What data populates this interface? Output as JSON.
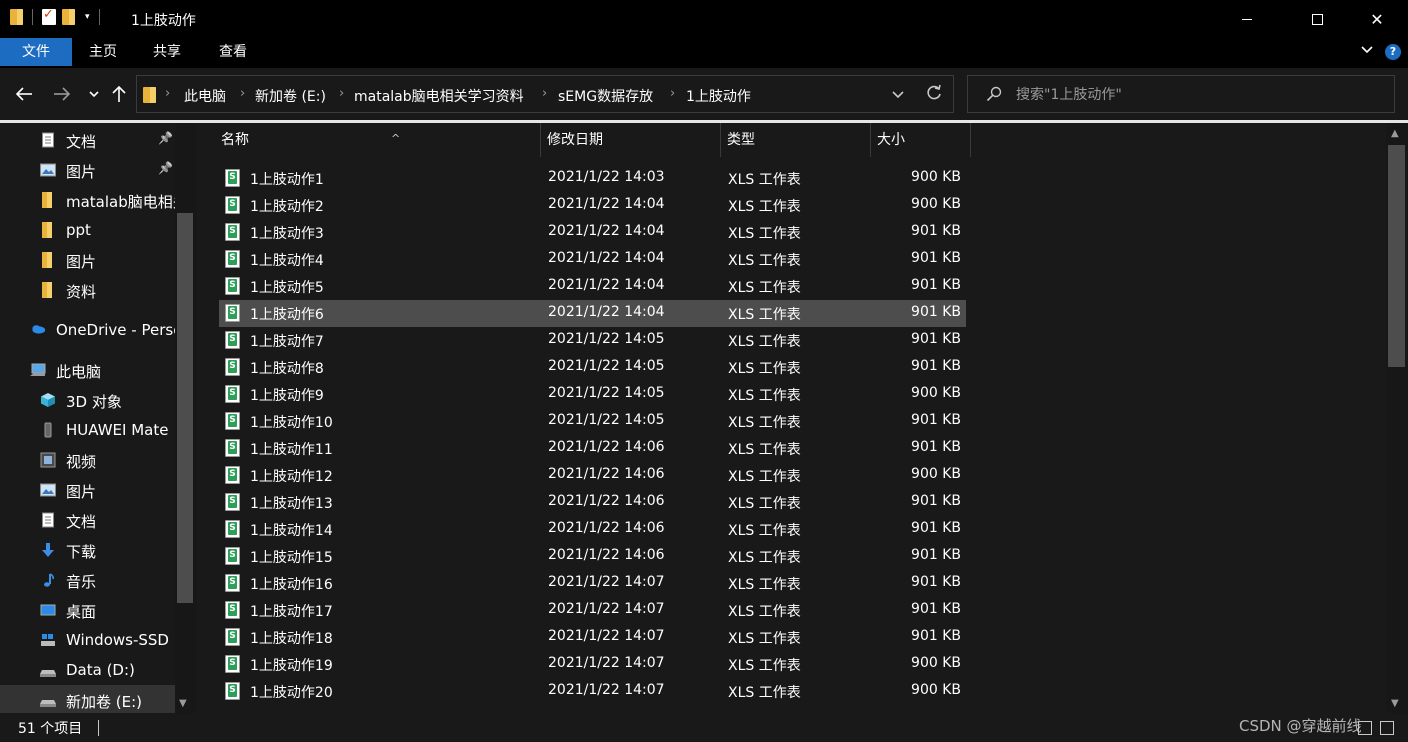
{
  "window": {
    "title": "1上肢动作"
  },
  "ribbon": {
    "tabs": [
      "文件",
      "主页",
      "共享",
      "查看"
    ]
  },
  "address": {
    "crumbs": [
      "此电脑",
      "新加卷 (E:)",
      "matalab脑电相关学习资料",
      "sEMG数据存放",
      "1上肢动作"
    ]
  },
  "search": {
    "placeholder": "搜索\"1上肢动作\""
  },
  "nav": {
    "items": [
      {
        "label": "文档",
        "icon": "document-icon",
        "pinned": true
      },
      {
        "label": "图片",
        "icon": "picture-icon",
        "pinned": true
      },
      {
        "label": "matalab脑电相关",
        "icon": "folder-icon",
        "pinned": false
      },
      {
        "label": "ppt",
        "icon": "folder-icon",
        "pinned": false
      },
      {
        "label": "图片",
        "icon": "folder-icon",
        "pinned": false
      },
      {
        "label": "资料",
        "icon": "folder-icon",
        "pinned": false
      },
      {
        "label": "OneDrive - Perso",
        "icon": "onedrive-icon",
        "pinned": false
      },
      {
        "label": "此电脑",
        "icon": "computer-icon",
        "pinned": false
      },
      {
        "label": "3D 对象",
        "icon": "cube-icon",
        "pinned": false
      },
      {
        "label": "HUAWEI Mate :",
        "icon": "phone-icon",
        "pinned": false
      },
      {
        "label": "视频",
        "icon": "video-icon",
        "pinned": false
      },
      {
        "label": "图片",
        "icon": "picture-icon",
        "pinned": false
      },
      {
        "label": "文档",
        "icon": "document-icon",
        "pinned": false
      },
      {
        "label": "下载",
        "icon": "download-icon",
        "pinned": false
      },
      {
        "label": "音乐",
        "icon": "music-icon",
        "pinned": false
      },
      {
        "label": "桌面",
        "icon": "desktop-icon",
        "pinned": false
      },
      {
        "label": "Windows-SSD (",
        "icon": "windows-drive-icon",
        "pinned": false
      },
      {
        "label": "Data (D:)",
        "icon": "drive-icon",
        "pinned": false
      },
      {
        "label": "新加卷 (E:)",
        "icon": "drive-icon",
        "pinned": false
      }
    ]
  },
  "columns": [
    "名称",
    "修改日期",
    "类型",
    "大小"
  ],
  "files": [
    {
      "name": "1上肢动作1",
      "date": "2021/1/22 14:03",
      "type": "XLS 工作表",
      "size": "900 KB"
    },
    {
      "name": "1上肢动作2",
      "date": "2021/1/22 14:04",
      "type": "XLS 工作表",
      "size": "900 KB"
    },
    {
      "name": "1上肢动作3",
      "date": "2021/1/22 14:04",
      "type": "XLS 工作表",
      "size": "901 KB"
    },
    {
      "name": "1上肢动作4",
      "date": "2021/1/22 14:04",
      "type": "XLS 工作表",
      "size": "901 KB"
    },
    {
      "name": "1上肢动作5",
      "date": "2021/1/22 14:04",
      "type": "XLS 工作表",
      "size": "901 KB"
    },
    {
      "name": "1上肢动作6",
      "date": "2021/1/22 14:04",
      "type": "XLS 工作表",
      "size": "901 KB"
    },
    {
      "name": "1上肢动作7",
      "date": "2021/1/22 14:05",
      "type": "XLS 工作表",
      "size": "901 KB"
    },
    {
      "name": "1上肢动作8",
      "date": "2021/1/22 14:05",
      "type": "XLS 工作表",
      "size": "901 KB"
    },
    {
      "name": "1上肢动作9",
      "date": "2021/1/22 14:05",
      "type": "XLS 工作表",
      "size": "900 KB"
    },
    {
      "name": "1上肢动作10",
      "date": "2021/1/22 14:05",
      "type": "XLS 工作表",
      "size": "901 KB"
    },
    {
      "name": "1上肢动作11",
      "date": "2021/1/22 14:06",
      "type": "XLS 工作表",
      "size": "901 KB"
    },
    {
      "name": "1上肢动作12",
      "date": "2021/1/22 14:06",
      "type": "XLS 工作表",
      "size": "900 KB"
    },
    {
      "name": "1上肢动作13",
      "date": "2021/1/22 14:06",
      "type": "XLS 工作表",
      "size": "901 KB"
    },
    {
      "name": "1上肢动作14",
      "date": "2021/1/22 14:06",
      "type": "XLS 工作表",
      "size": "901 KB"
    },
    {
      "name": "1上肢动作15",
      "date": "2021/1/22 14:06",
      "type": "XLS 工作表",
      "size": "901 KB"
    },
    {
      "name": "1上肢动作16",
      "date": "2021/1/22 14:07",
      "type": "XLS 工作表",
      "size": "901 KB"
    },
    {
      "name": "1上肢动作17",
      "date": "2021/1/22 14:07",
      "type": "XLS 工作表",
      "size": "901 KB"
    },
    {
      "name": "1上肢动作18",
      "date": "2021/1/22 14:07",
      "type": "XLS 工作表",
      "size": "901 KB"
    },
    {
      "name": "1上肢动作19",
      "date": "2021/1/22 14:07",
      "type": "XLS 工作表",
      "size": "900 KB"
    },
    {
      "name": "1上肢动作20",
      "date": "2021/1/22 14:07",
      "type": "XLS 工作表",
      "size": "900 KB"
    }
  ],
  "status": {
    "count": "51 个项目"
  },
  "watermark": "CSDN @穿越前线",
  "colors": {
    "accent": "#1c6cc2",
    "selected_row": "#4d4d4d",
    "folder": "#e9b33b",
    "xls_green": "#2e9e5a"
  }
}
